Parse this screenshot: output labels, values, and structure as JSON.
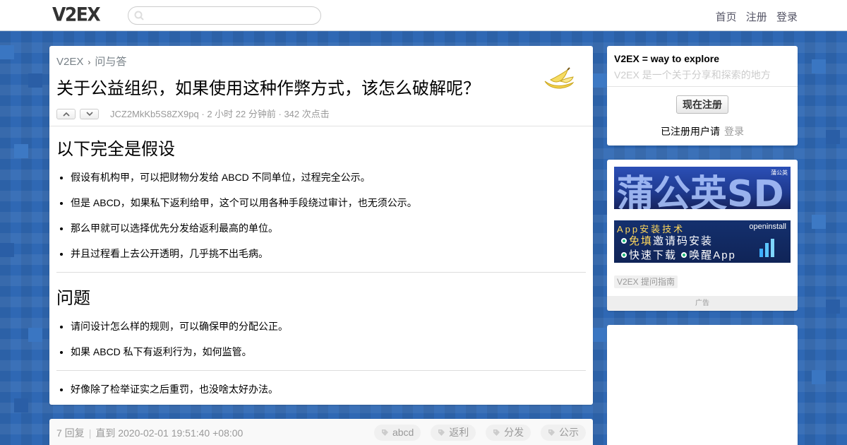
{
  "header": {
    "logo": "V2EX",
    "search": {
      "value": "",
      "placeholder": ""
    },
    "nav": [
      "首页",
      "注册",
      "登录"
    ]
  },
  "topic": {
    "breadcrumb": {
      "home": "V2EX",
      "separator": "›",
      "node": "问与答"
    },
    "title": "关于公益组织，如果使用这种作弊方式，该怎么破解呢？",
    "author": "JCZ2MkKb5S8ZX9pq",
    "time": "2 小时 22 分钟前",
    "clicks": "342 次点击",
    "meta_separator": "·",
    "sections": [
      {
        "heading": "以下完全是假设",
        "items": [
          "假设有机构甲，可以把财物分发给 ABCD 不同单位，过程完全公示。",
          "但是 ABCD，如果私下返利给甲，这个可以用各种手段绕过审计，也无须公示。",
          "那么甲就可以选择优先分发给返利最高的单位。",
          "并且过程看上去公开透明，几乎挑不出毛病。"
        ]
      },
      {
        "heading": "问题",
        "items": [
          "请问设计怎么样的规则，可以确保甲的分配公正。",
          "如果 ABCD 私下有返利行为，如何监管。"
        ]
      },
      {
        "heading": "",
        "items": [
          "好像除了检举证实之后重罚，也没啥太好办法。"
        ]
      }
    ]
  },
  "topic_footer": {
    "replies": "7 回复",
    "separator": "|",
    "until": "直到 2020-02-01 19:51:40 +08:00",
    "tags": [
      "abcd",
      "返利",
      "分发",
      "公示"
    ]
  },
  "sidebar": {
    "welcome_title": "V2EX = way to explore",
    "welcome_sub": "V2EX 是一个关于分享和探索的地方",
    "register_button": "现在注册",
    "registered_text": "已注册用户请",
    "login_link": "登录",
    "ad1": {
      "text": "蒲公英SD",
      "badge": "蒲公英"
    },
    "ad2": {
      "line1": "App安装技术",
      "brand": "openinstall",
      "line2_pre": "免填",
      "line2_post": "邀请码安装",
      "line3_a": "快速下载",
      "line3_b": "唤醒App"
    },
    "ad_link": "V2EX 提问指南",
    "ad_label": "广告"
  },
  "colors": {
    "background": "#2f68b4",
    "muted_text": "#999999",
    "link_gray": "#778087"
  }
}
